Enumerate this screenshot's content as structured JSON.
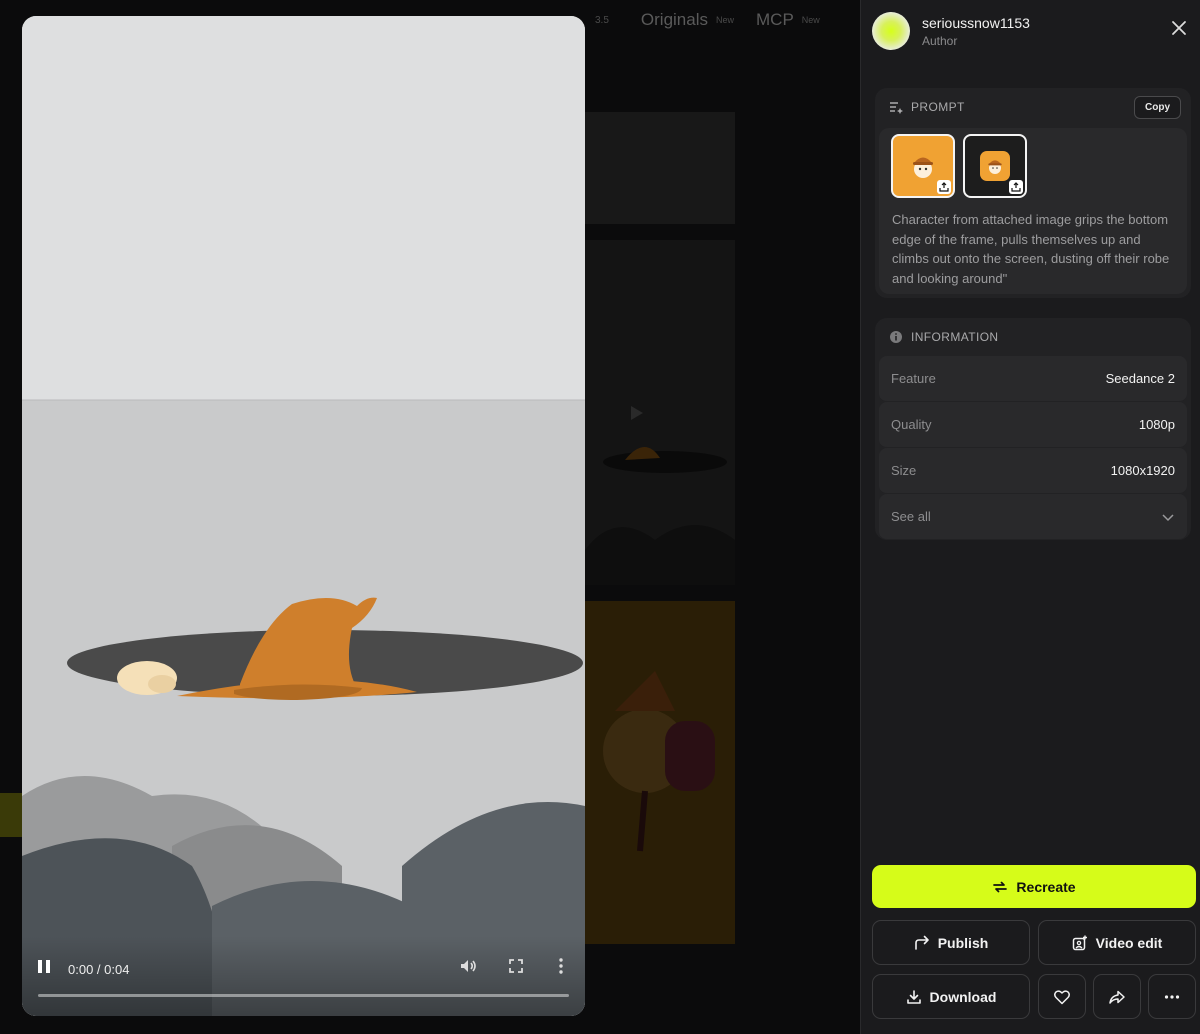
{
  "background": {
    "nav": [
      {
        "label": "Originals",
        "badge": "New"
      },
      {
        "label": "MCP",
        "badge": "New"
      }
    ],
    "version": "3.5"
  },
  "player": {
    "time": "0:00 / 0:04",
    "progress": 0
  },
  "panel": {
    "author": {
      "name": "serioussnow1153",
      "role": "Author"
    },
    "prompt": {
      "heading": "PROMPT",
      "copy_label": "Copy",
      "text": "Character from attached image grips the bottom edge of the frame, pulls themselves up and climbs out onto the screen, dusting off their robe and looking around\""
    },
    "information": {
      "heading": "INFORMATION",
      "rows": [
        {
          "key": "Feature",
          "value": "Seedance 2"
        },
        {
          "key": "Quality",
          "value": "1080p"
        },
        {
          "key": "Size",
          "value": "1080x1920"
        }
      ],
      "see_all": "See all"
    },
    "actions": {
      "recreate": "Recreate",
      "publish": "Publish",
      "video_edit": "Video edit",
      "download": "Download"
    }
  },
  "colors": {
    "accent": "#d6fc19",
    "panel_bg": "#1b1b1d",
    "card_bg": "#222224",
    "hat": "#cf7f2c"
  }
}
